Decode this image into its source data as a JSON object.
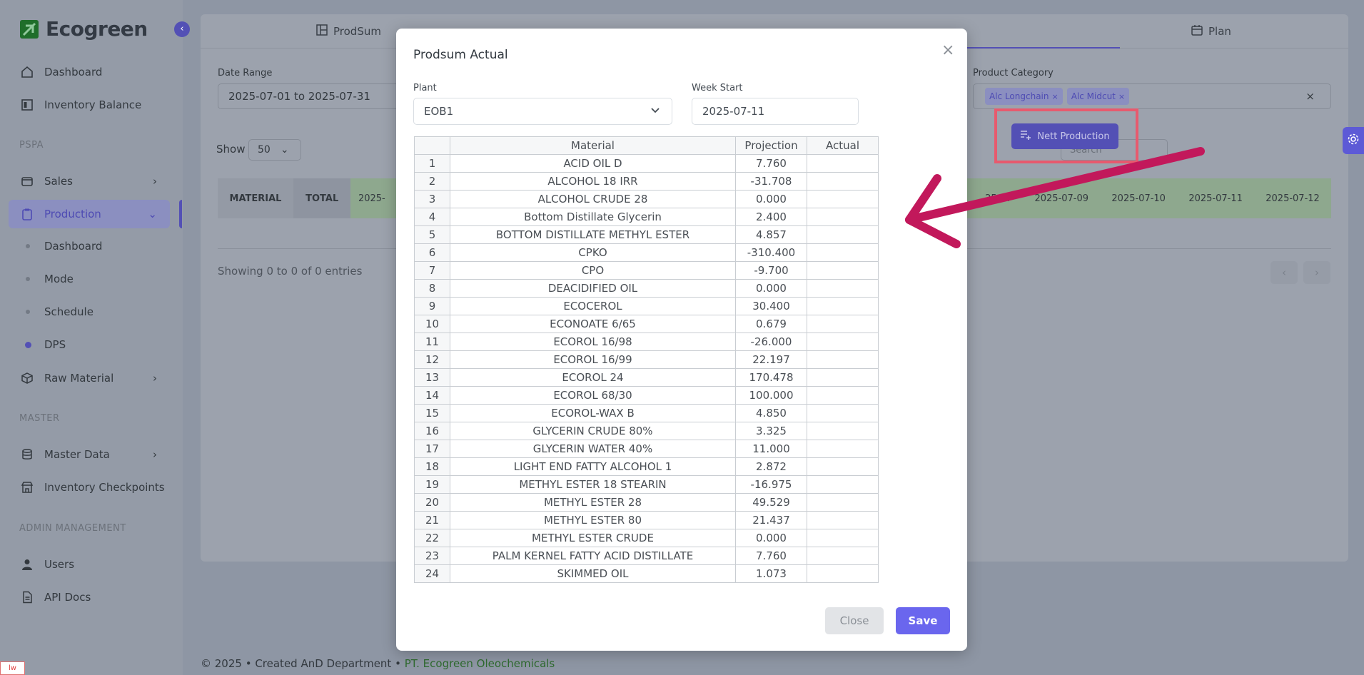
{
  "brand": {
    "name": "Ecogreen"
  },
  "sidebar": {
    "items": {
      "dashboard": "Dashboard",
      "inventory_balance": "Inventory Balance",
      "section_pspa": "PSPA",
      "sales": "Sales",
      "production": "Production",
      "sub_dashboard": "Dashboard",
      "sub_mode": "Mode",
      "sub_schedule": "Schedule",
      "sub_dps": "DPS",
      "raw_material": "Raw Material",
      "section_master": "MASTER",
      "master_data": "Master Data",
      "inventory_checkpoints": "Inventory Checkpoints",
      "section_admin": "ADMIN MANAGEMENT",
      "users": "Users",
      "api_docs": "API Docs"
    }
  },
  "tabs": {
    "prodsum": "ProdSum",
    "plan": "Plan"
  },
  "filters": {
    "date_range_label": "Date Range",
    "date_range_value": "2025-07-01 to 2025-07-31",
    "product_category_label": "Product Category",
    "chips": [
      "Alc Longchain",
      "Alc Midcut"
    ],
    "clear": "×"
  },
  "list_controls": {
    "show_label": "Show",
    "show_value": "50",
    "search_placeholder": "Search",
    "nett_production": "Nett Production"
  },
  "background_table": {
    "headers": [
      "MATERIAL",
      "TOTAL",
      "2025-"
    ],
    "right_headers": [
      "25-07",
      "2025-07-09",
      "2025-07-10",
      "2025-07-11",
      "2025-07-12"
    ],
    "entries": "Showing 0 to 0 of 0 entries",
    "prev": "‹",
    "next": "›"
  },
  "footer": {
    "text": "© 2025 • Created AnD Department •",
    "link": "PT. Ecogreen Oleochemicals"
  },
  "modal": {
    "title": "Prodsum Actual",
    "close_icon": "×",
    "plant_label": "Plant",
    "plant_value": "EOB1",
    "week_start_label": "Week Start",
    "week_start_value": "2025-07-11",
    "columns": [
      "",
      "Material",
      "Projection",
      "Actual"
    ],
    "rows": [
      {
        "no": "1",
        "material": "ACID OIL D",
        "projection": "7.760",
        "actual": ""
      },
      {
        "no": "2",
        "material": "ALCOHOL 18 IRR",
        "projection": "-31.708",
        "actual": ""
      },
      {
        "no": "3",
        "material": "ALCOHOL CRUDE 28",
        "projection": "0.000",
        "actual": ""
      },
      {
        "no": "4",
        "material": "Bottom Distillate Glycerin",
        "projection": "2.400",
        "actual": ""
      },
      {
        "no": "5",
        "material": "BOTTOM DISTILLATE METHYL ESTER",
        "projection": "4.857",
        "actual": ""
      },
      {
        "no": "6",
        "material": "CPKO",
        "projection": "-310.400",
        "actual": ""
      },
      {
        "no": "7",
        "material": "CPO",
        "projection": "-9.700",
        "actual": ""
      },
      {
        "no": "8",
        "material": "DEACIDIFIED OIL",
        "projection": "0.000",
        "actual": ""
      },
      {
        "no": "9",
        "material": "ECOCEROL",
        "projection": "30.400",
        "actual": ""
      },
      {
        "no": "10",
        "material": "ECONOATE 6/65",
        "projection": "0.679",
        "actual": ""
      },
      {
        "no": "11",
        "material": "ECOROL 16/98",
        "projection": "-26.000",
        "actual": ""
      },
      {
        "no": "12",
        "material": "ECOROL 16/99",
        "projection": "22.197",
        "actual": ""
      },
      {
        "no": "13",
        "material": "ECOROL 24",
        "projection": "170.478",
        "actual": ""
      },
      {
        "no": "14",
        "material": "ECOROL 68/30",
        "projection": "100.000",
        "actual": ""
      },
      {
        "no": "15",
        "material": "ECOROL-WAX B",
        "projection": "4.850",
        "actual": ""
      },
      {
        "no": "16",
        "material": "GLYCERIN CRUDE 80%",
        "projection": "3.325",
        "actual": ""
      },
      {
        "no": "17",
        "material": "GLYCERIN WATER 40%",
        "projection": "11.000",
        "actual": ""
      },
      {
        "no": "18",
        "material": "LIGHT END FATTY ALCOHOL 1",
        "projection": "2.872",
        "actual": ""
      },
      {
        "no": "19",
        "material": "METHYL ESTER 18 STEARIN",
        "projection": "-16.975",
        "actual": ""
      },
      {
        "no": "20",
        "material": "METHYL ESTER 28",
        "projection": "49.529",
        "actual": ""
      },
      {
        "no": "21",
        "material": "METHYL ESTER 80",
        "projection": "21.437",
        "actual": ""
      },
      {
        "no": "22",
        "material": "METHYL ESTER CRUDE",
        "projection": "0.000",
        "actual": ""
      },
      {
        "no": "23",
        "material": "PALM KERNEL FATTY ACID DISTILLATE",
        "projection": "7.760",
        "actual": ""
      },
      {
        "no": "24",
        "material": "SKIMMED OIL",
        "projection": "1.073",
        "actual": ""
      }
    ],
    "close_button": "Close",
    "save_button": "Save"
  },
  "colors": {
    "accent": "#5350b5",
    "save": "#6a66ee",
    "annotation": "#c2185b",
    "highlight_box": "#e75a6e"
  },
  "icons": {
    "brand_logo": "leaf-logo-icon",
    "collapse": "chevron-left-icon",
    "settings": "gear-icon"
  }
}
